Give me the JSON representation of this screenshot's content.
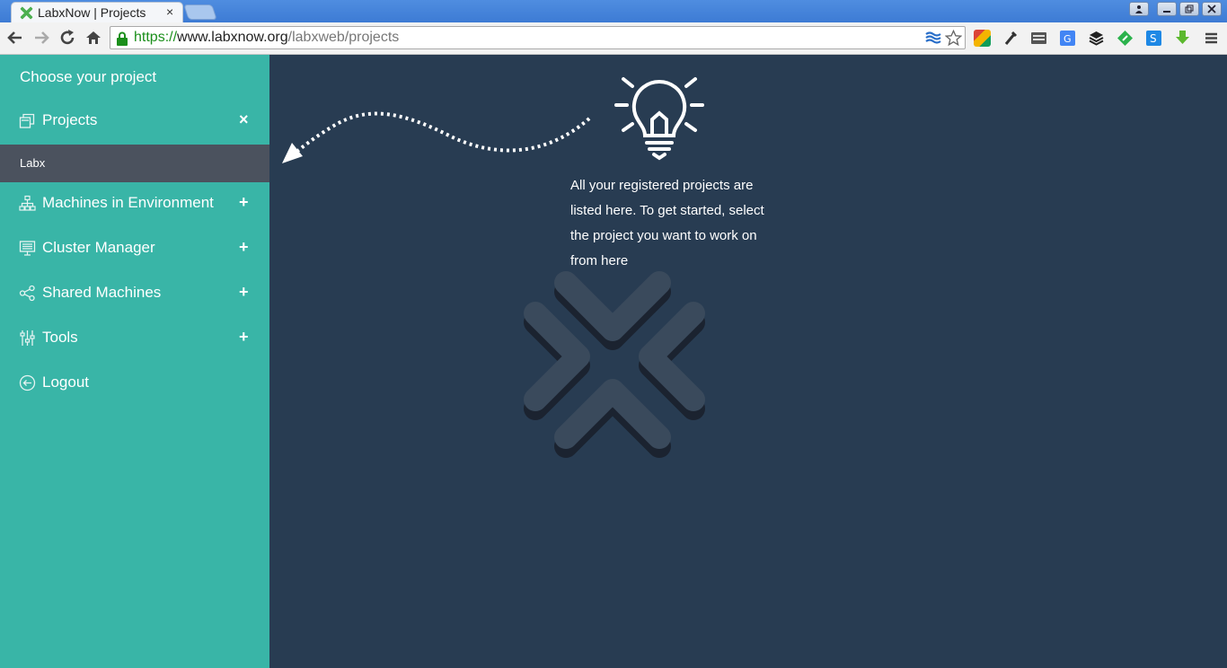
{
  "browser": {
    "tab_title": "LabxNow | Projects",
    "tab_close": "×",
    "url_scheme": "https://",
    "url_host": "www.labxnow.org",
    "url_path": "/labxweb/projects"
  },
  "sidebar": {
    "title": "Choose your project",
    "items": [
      {
        "label": "Projects",
        "toggle": "×",
        "icon": "projects-icon"
      },
      {
        "label": "Machines in Environment",
        "toggle": "+",
        "icon": "network-icon"
      },
      {
        "label": "Cluster Manager",
        "toggle": "+",
        "icon": "monitor-icon"
      },
      {
        "label": "Shared Machines",
        "toggle": "+",
        "icon": "share-icon"
      },
      {
        "label": "Tools",
        "toggle": "+",
        "icon": "tools-icon"
      },
      {
        "label": "Logout",
        "icon": "logout-icon"
      }
    ],
    "project_entry": "Labx"
  },
  "main": {
    "hint_text": "All your registered projects are listed here. To get started, select the project you want to work on from here"
  },
  "colors": {
    "sidebar_bg": "#39b5a7",
    "main_bg": "#283c52",
    "selected_project_bg": "#4b525e"
  }
}
